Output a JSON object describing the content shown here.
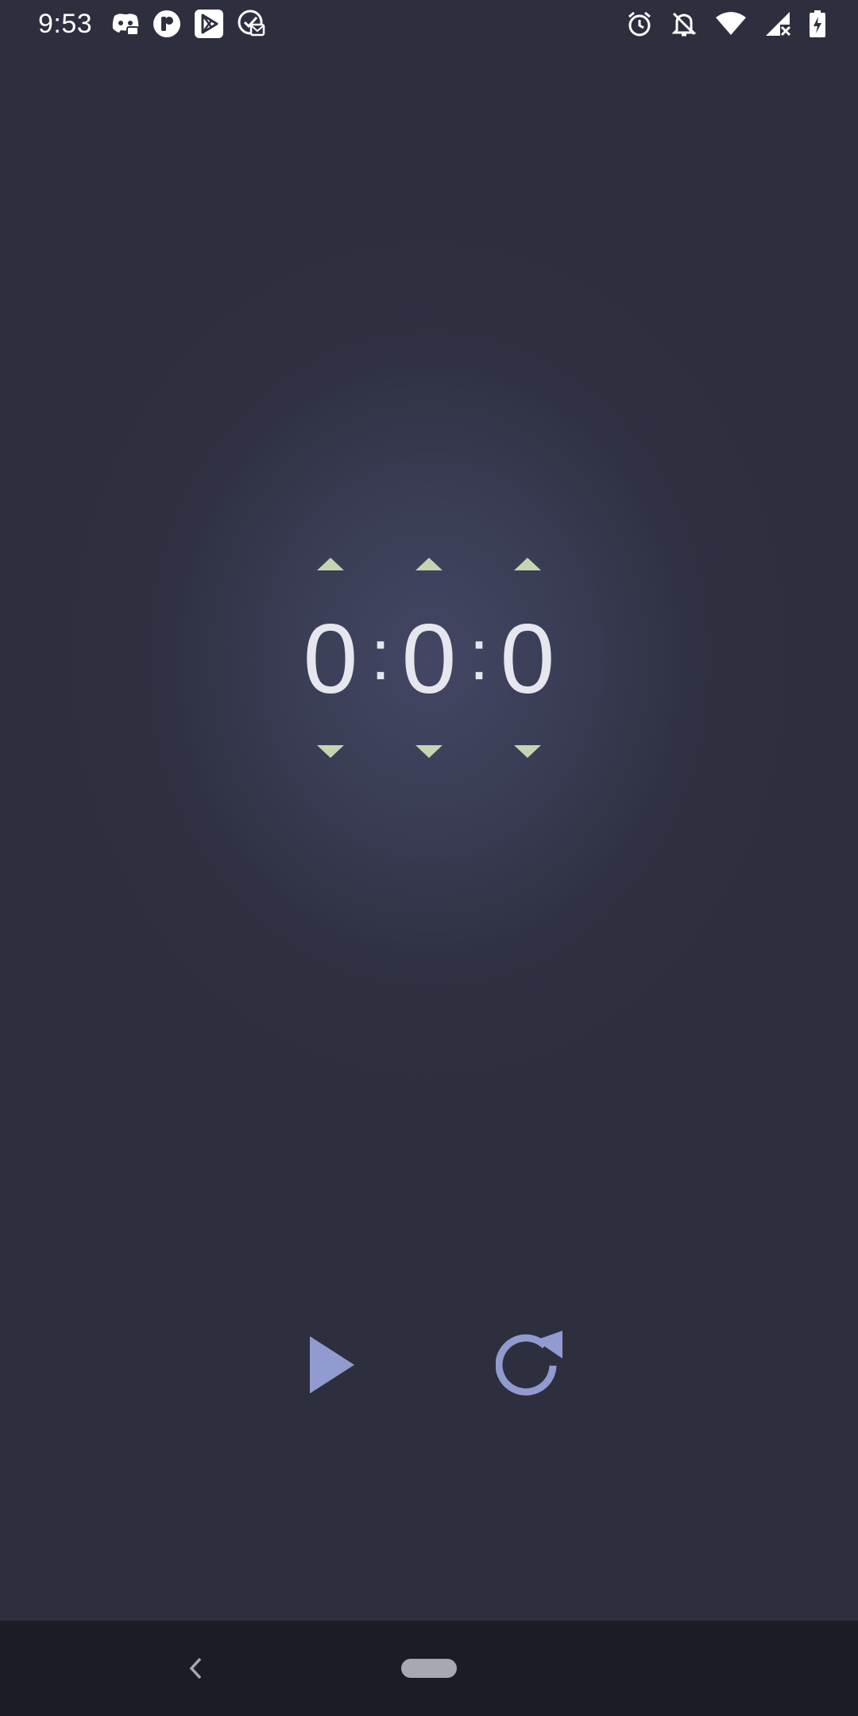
{
  "status_bar": {
    "time": "9:53",
    "left_icons": [
      "discord-icon",
      "app-p-icon",
      "play-store-icon",
      "check-mail-icon"
    ],
    "right_icons": [
      "alarm-icon",
      "bell-off-icon",
      "wifi-icon",
      "signal-off-icon",
      "battery-charging-icon"
    ]
  },
  "timer": {
    "hours": "0",
    "minutes": "0",
    "seconds": "0",
    "separator": ":"
  },
  "colors": {
    "background": "#2d2f3e",
    "glow": "#434764",
    "digit": "#e6e7ee",
    "arrow": "#c5d5b2",
    "control": "#929bcf",
    "nav_bar": "#1b1c24"
  },
  "controls": {
    "play_icon": "play-icon",
    "reset_icon": "reset-icon"
  },
  "nav_bar": {
    "back_icon": "back-chevron-icon",
    "home_icon": "home-pill-icon"
  }
}
